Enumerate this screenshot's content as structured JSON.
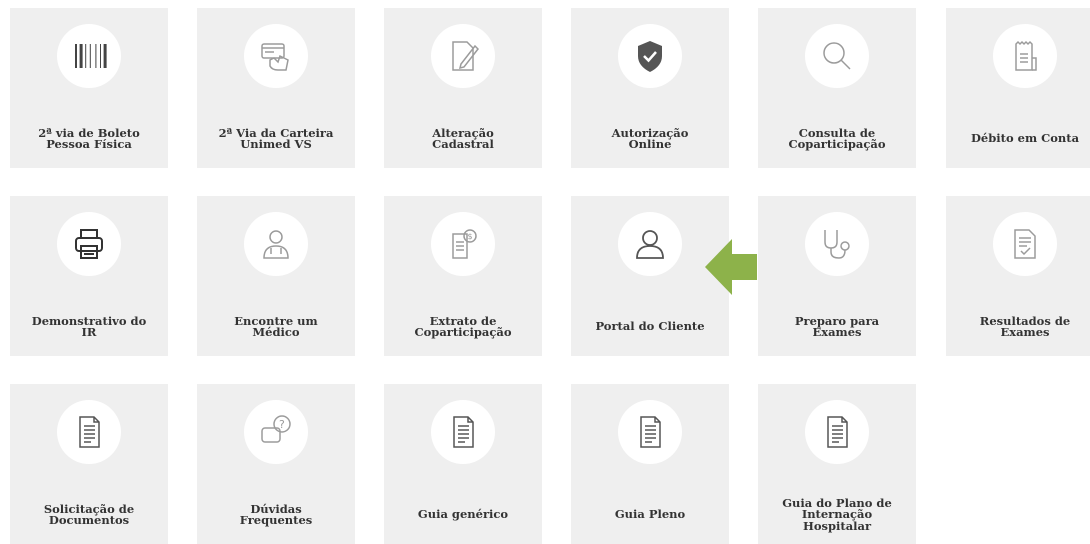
{
  "colors": {
    "tile_bg": "#efefef",
    "icon_stroke": "#9b9b9b",
    "shield": "#555555",
    "arrow": "#8db24a"
  },
  "tiles": [
    {
      "label": "2ª via de Boleto\nPessoa Física",
      "icon": "barcode-icon"
    },
    {
      "label": "2ª Via da Carteira\nUnimed VS",
      "icon": "card-hand-icon"
    },
    {
      "label": "Alteração\nCadastral",
      "icon": "edit-document-icon"
    },
    {
      "label": "Autorização\nOnline",
      "icon": "shield-check-icon"
    },
    {
      "label": "Consulta de\nCoparticipação",
      "icon": "search-icon"
    },
    {
      "label": "Débito em Conta",
      "icon": "receipt-icon"
    },
    {
      "label": "Demonstrativo do\nIR",
      "icon": "printer-icon"
    },
    {
      "label": "Encontre um\nMédico",
      "icon": "doctor-icon"
    },
    {
      "label": "Extrato de\nCoparticipação",
      "icon": "statement-icon"
    },
    {
      "label": "Portal do Cliente",
      "icon": "user-icon"
    },
    {
      "label": "Preparo para\nExames",
      "icon": "stethoscope-icon"
    },
    {
      "label": "Resultados de\nExames",
      "icon": "document-check-icon"
    },
    {
      "label": "Solicitação de\nDocumentos",
      "icon": "document-icon"
    },
    {
      "label": "Dúvidas\nFrequentes",
      "icon": "chat-question-icon"
    },
    {
      "label": "Guia genérico",
      "icon": "document-icon"
    },
    {
      "label": "Guia Pleno",
      "icon": "document-icon"
    },
    {
      "label": "Guia do Plano de\nInternação\nHospitalar",
      "icon": "document-icon"
    }
  ],
  "pointer": {
    "icon": "arrow-left-icon",
    "target": "Portal do Cliente"
  }
}
